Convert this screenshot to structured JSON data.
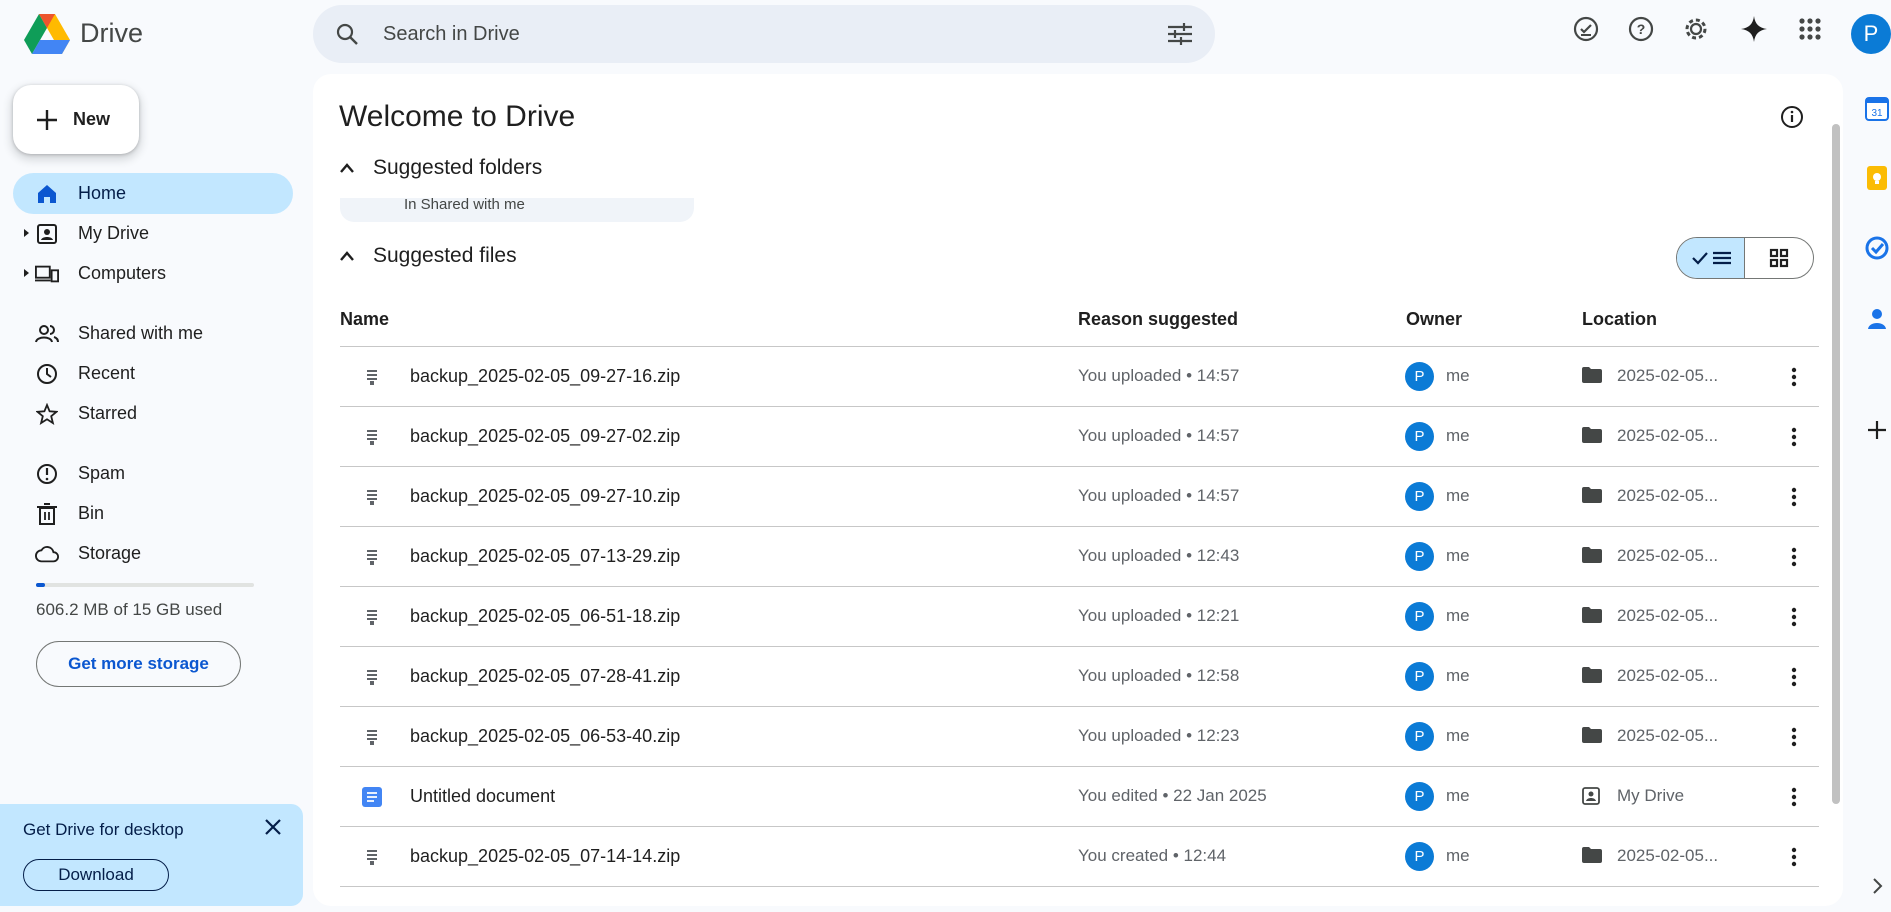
{
  "header": {
    "app_name": "Drive",
    "search_placeholder": "Search in Drive",
    "avatar_letter": "P"
  },
  "sidebar": {
    "new_label": "New",
    "items": [
      {
        "label": "Home",
        "icon": "home-icon",
        "active": true
      },
      {
        "label": "My Drive",
        "icon": "my-drive-icon"
      },
      {
        "label": "Computers",
        "icon": "computers-icon"
      },
      {
        "label": "Shared with me",
        "icon": "shared-icon"
      },
      {
        "label": "Recent",
        "icon": "clock-icon"
      },
      {
        "label": "Starred",
        "icon": "star-icon"
      },
      {
        "label": "Spam",
        "icon": "spam-icon"
      },
      {
        "label": "Bin",
        "icon": "trash-icon"
      },
      {
        "label": "Storage",
        "icon": "cloud-icon"
      }
    ],
    "storage_text": "606.2 MB of 15 GB used",
    "storage_fraction": 0.04,
    "get_storage_label": "Get more storage",
    "promo": {
      "title": "Get Drive for desktop",
      "button": "Download"
    }
  },
  "main": {
    "title": "Welcome to Drive",
    "suggested_folders_label": "Suggested folders",
    "folder_card_text": "In Shared with me",
    "suggested_files_label": "Suggested files",
    "columns": {
      "name": "Name",
      "reason": "Reason suggested",
      "owner": "Owner",
      "location": "Location"
    },
    "files": [
      {
        "name": "backup_2025-02-05_09-27-16.zip",
        "reason": "You uploaded • 14:57",
        "owner": "me",
        "owner_letter": "P",
        "location": "2025-02-05...",
        "type": "zip"
      },
      {
        "name": "backup_2025-02-05_09-27-02.zip",
        "reason": "You uploaded • 14:57",
        "owner": "me",
        "owner_letter": "P",
        "location": "2025-02-05...",
        "type": "zip"
      },
      {
        "name": "backup_2025-02-05_09-27-10.zip",
        "reason": "You uploaded • 14:57",
        "owner": "me",
        "owner_letter": "P",
        "location": "2025-02-05...",
        "type": "zip"
      },
      {
        "name": "backup_2025-02-05_07-13-29.zip",
        "reason": "You uploaded • 12:43",
        "owner": "me",
        "owner_letter": "P",
        "location": "2025-02-05...",
        "type": "zip"
      },
      {
        "name": "backup_2025-02-05_06-51-18.zip",
        "reason": "You uploaded • 12:21",
        "owner": "me",
        "owner_letter": "P",
        "location": "2025-02-05...",
        "type": "zip"
      },
      {
        "name": "backup_2025-02-05_07-28-41.zip",
        "reason": "You uploaded • 12:58",
        "owner": "me",
        "owner_letter": "P",
        "location": "2025-02-05...",
        "type": "zip"
      },
      {
        "name": "backup_2025-02-05_06-53-40.zip",
        "reason": "You uploaded • 12:23",
        "owner": "me",
        "owner_letter": "P",
        "location": "2025-02-05...",
        "type": "zip"
      },
      {
        "name": "Untitled document",
        "reason": "You edited • 22 Jan 2025",
        "owner": "me",
        "owner_letter": "P",
        "location": "My Drive",
        "type": "doc"
      },
      {
        "name": "backup_2025-02-05_07-14-14.zip",
        "reason": "You created • 12:44",
        "owner": "me",
        "owner_letter": "P",
        "location": "2025-02-05...",
        "type": "zip"
      }
    ]
  },
  "colors": {
    "accent": "#0b57d0",
    "active_bg": "#c2e7ff",
    "avatar": "#0b7bd6"
  }
}
